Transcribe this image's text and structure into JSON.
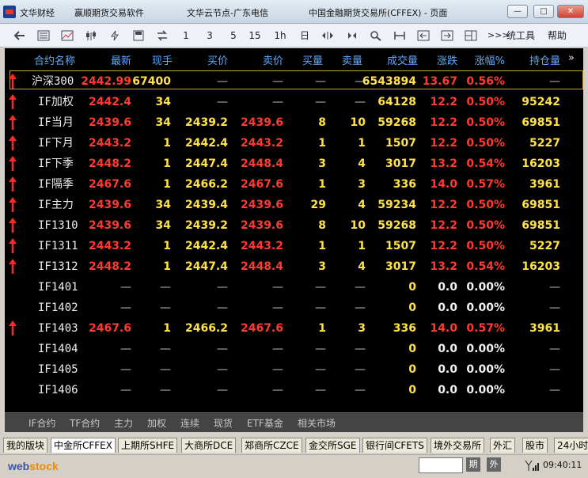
{
  "window": {
    "app_name": "文华财经",
    "software": "赢顺期货交易软件",
    "node": "文华云节点-广东电信",
    "exchange": "中国金融期货交易所(CFFEX) - 页面",
    "min": "—",
    "max": "□",
    "close": "✕"
  },
  "toolbar": {
    "t1": "1",
    "t3": "3",
    "t5": "5",
    "t15": "15",
    "t1h": "1h",
    "day": "日",
    "more": ">>>",
    "system_tools": "统工具",
    "help": "帮助"
  },
  "headers": [
    "合约名称",
    "最新",
    "现手",
    "买价",
    "卖价",
    "买量",
    "卖量",
    "成交量",
    "涨跌",
    "涨幅%",
    "持仓量"
  ],
  "more_cols": "»",
  "rows": [
    {
      "arrow": true,
      "name": "沪深300",
      "last": "2442.99",
      "vol": "67400",
      "bid": "—",
      "ask": "—",
      "bq": "—",
      "aq": "—",
      "total": "6543894",
      "chg": "13.67",
      "pct": "0.56%",
      "oi": "—"
    },
    {
      "arrow": true,
      "name": "IF加权",
      "last": "2442.4",
      "vol": "34",
      "bid": "—",
      "ask": "—",
      "bq": "—",
      "aq": "—",
      "total": "64128",
      "chg": "12.2",
      "pct": "0.50%",
      "oi": "95242"
    },
    {
      "arrow": true,
      "name": "IF当月",
      "last": "2439.6",
      "vol": "34",
      "bid": "2439.2",
      "ask": "2439.6",
      "bq": "8",
      "aq": "10",
      "total": "59268",
      "chg": "12.2",
      "pct": "0.50%",
      "oi": "69851"
    },
    {
      "arrow": true,
      "name": "IF下月",
      "last": "2443.2",
      "vol": "1",
      "bid": "2442.4",
      "ask": "2443.2",
      "bq": "1",
      "aq": "1",
      "total": "1507",
      "chg": "12.2",
      "pct": "0.50%",
      "oi": "5227"
    },
    {
      "arrow": true,
      "name": "IF下季",
      "last": "2448.2",
      "vol": "1",
      "bid": "2447.4",
      "ask": "2448.4",
      "bq": "3",
      "aq": "4",
      "total": "3017",
      "chg": "13.2",
      "pct": "0.54%",
      "oi": "16203"
    },
    {
      "arrow": true,
      "name": "IF隔季",
      "last": "2467.6",
      "vol": "1",
      "bid": "2466.2",
      "ask": "2467.6",
      "bq": "1",
      "aq": "3",
      "total": "336",
      "chg": "14.0",
      "pct": "0.57%",
      "oi": "3961"
    },
    {
      "arrow": true,
      "name": "IF主力",
      "last": "2439.6",
      "vol": "34",
      "bid": "2439.4",
      "ask": "2439.6",
      "bq": "29",
      "aq": "4",
      "total": "59234",
      "chg": "12.2",
      "pct": "0.50%",
      "oi": "69851"
    },
    {
      "arrow": true,
      "name": "IF1310",
      "last": "2439.6",
      "vol": "34",
      "bid": "2439.2",
      "ask": "2439.6",
      "bq": "8",
      "aq": "10",
      "total": "59268",
      "chg": "12.2",
      "pct": "0.50%",
      "oi": "69851"
    },
    {
      "arrow": true,
      "name": "IF1311",
      "last": "2443.2",
      "vol": "1",
      "bid": "2442.4",
      "ask": "2443.2",
      "bq": "1",
      "aq": "1",
      "total": "1507",
      "chg": "12.2",
      "pct": "0.50%",
      "oi": "5227"
    },
    {
      "arrow": true,
      "name": "IF1312",
      "last": "2448.2",
      "vol": "1",
      "bid": "2447.4",
      "ask": "2448.4",
      "bq": "3",
      "aq": "4",
      "total": "3017",
      "chg": "13.2",
      "pct": "0.54%",
      "oi": "16203"
    },
    {
      "arrow": false,
      "name": "IF1401",
      "last": "—",
      "vol": "—",
      "bid": "—",
      "ask": "—",
      "bq": "—",
      "aq": "—",
      "total": "0",
      "chg": "0.0",
      "pct": "0.00%",
      "oi": "—"
    },
    {
      "arrow": false,
      "name": "IF1402",
      "last": "—",
      "vol": "—",
      "bid": "—",
      "ask": "—",
      "bq": "—",
      "aq": "—",
      "total": "0",
      "chg": "0.0",
      "pct": "0.00%",
      "oi": "—"
    },
    {
      "arrow": true,
      "name": "IF1403",
      "last": "2467.6",
      "vol": "1",
      "bid": "2466.2",
      "ask": "2467.6",
      "bq": "1",
      "aq": "3",
      "total": "336",
      "chg": "14.0",
      "pct": "0.57%",
      "oi": "3961"
    },
    {
      "arrow": false,
      "name": "IF1404",
      "last": "—",
      "vol": "—",
      "bid": "—",
      "ask": "—",
      "bq": "—",
      "aq": "—",
      "total": "0",
      "chg": "0.0",
      "pct": "0.00%",
      "oi": "—"
    },
    {
      "arrow": false,
      "name": "IF1405",
      "last": "—",
      "vol": "—",
      "bid": "—",
      "ask": "—",
      "bq": "—",
      "aq": "—",
      "total": "0",
      "chg": "0.0",
      "pct": "0.00%",
      "oi": "—"
    },
    {
      "arrow": false,
      "name": "IF1406",
      "last": "—",
      "vol": "—",
      "bid": "—",
      "ask": "—",
      "bq": "—",
      "aq": "—",
      "total": "0",
      "chg": "0.0",
      "pct": "0.00%",
      "oi": "—"
    }
  ],
  "subtabs": [
    "IF合约",
    "TF合约",
    "主力",
    "加权",
    "连续",
    "现货",
    "ETF基金",
    "相关市场"
  ],
  "market_tabs": [
    "我的版块",
    "中金所CFFEX",
    "上期所SHFE",
    "大商所DCE",
    "郑商所CZCE",
    "金交所SGE",
    "银行间CFETS",
    "境外交易所",
    "外汇",
    "股市",
    "24小时"
  ],
  "status": {
    "brand_a": "web",
    "brand_b": "stock",
    "btn_futures": "期",
    "btn_foreign": "外",
    "clock": "09:40:11"
  },
  "colors": {
    "up": "#ff3b2f",
    "neutral": "#ffe24a",
    "header": "#5fa8ff"
  }
}
